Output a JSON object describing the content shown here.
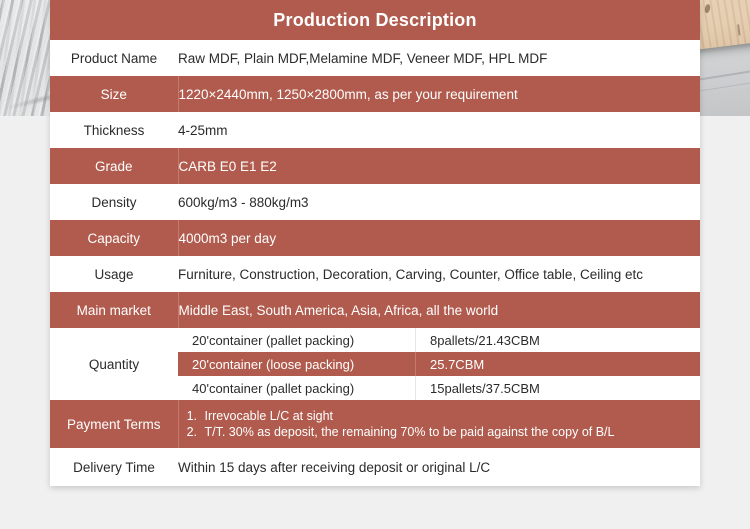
{
  "header": {
    "title": "Production Description"
  },
  "accent_colors": {
    "band": "#b05b4d",
    "band_text": "#ffffff",
    "plain": "#ffffff",
    "plain_text": "#2b2b2b",
    "page_background": "#f0f0f0"
  },
  "rows": [
    {
      "label": "Product Name",
      "value": "Raw MDF, Plain MDF,Melamine MDF, Veneer MDF, HPL MDF"
    },
    {
      "label": "Size",
      "value": "1220×2440mm,  1250×2800mm,  as per your requirement"
    },
    {
      "label": "Thickness",
      "value": "4-25mm"
    },
    {
      "label": "Grade",
      "value": "CARB    E0     E1     E2"
    },
    {
      "label": "Density",
      "value": "600kg/m3 - 880kg/m3"
    },
    {
      "label": "Capacity",
      "value": "4000m3 per day"
    },
    {
      "label": "Usage",
      "value": "Furniture, Construction, Decoration, Carving, Counter, Office table, Ceiling etc"
    },
    {
      "label": "Main market",
      "value": "Middle East, South America, Asia, Africa, all the world"
    }
  ],
  "quantity": {
    "label": "Quantity",
    "lines": [
      {
        "description": "20'container (pallet packing)",
        "amount": "8pallets/21.43CBM"
      },
      {
        "description": "20'container (loose packing)",
        "amount": "25.7CBM"
      },
      {
        "description": "40'container (pallet packing)",
        "amount": "15pallets/37.5CBM"
      }
    ]
  },
  "payment_terms": {
    "label": "Payment Terms",
    "items": [
      "Irrevocable L/C at sight",
      "T/T. 30% as deposit, the remaining  70% to be paid against the copy of B/L"
    ]
  },
  "delivery_time": {
    "label": "Delivery Time",
    "value": "Within 15 days after receiving deposit or original L/C"
  }
}
